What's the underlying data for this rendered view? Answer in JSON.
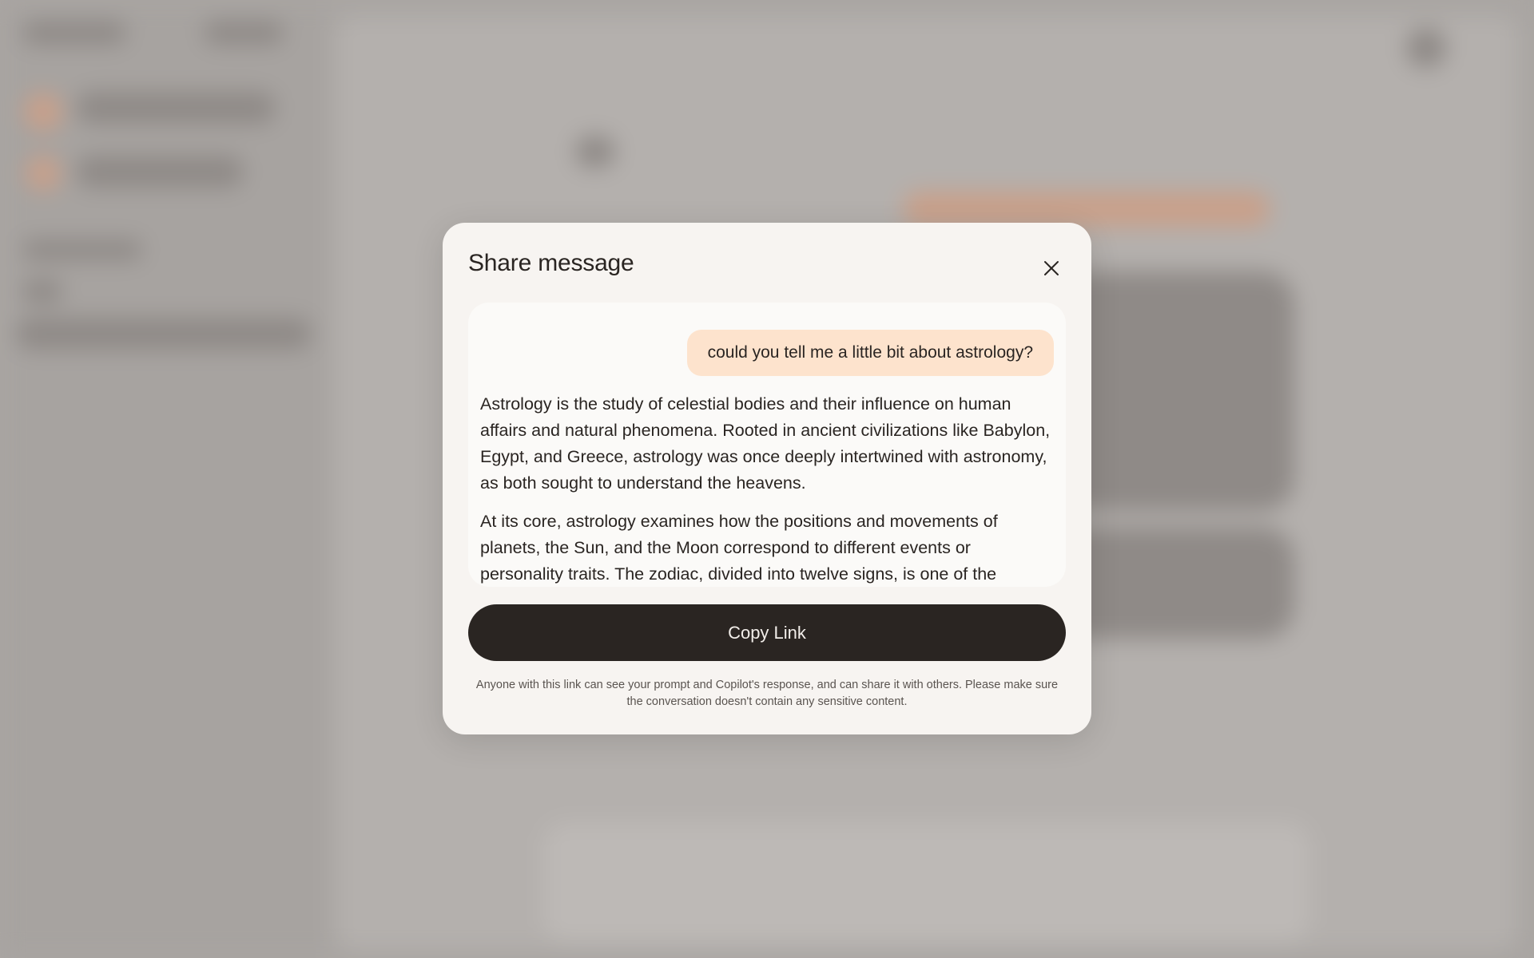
{
  "modal": {
    "title": "Share message",
    "user_prompt": "could you tell me a little bit about astrology?",
    "response_paragraphs": [
      "Astrology is the study of celestial bodies and their influence on human affairs and natural phenomena. Rooted in ancient civilizations like Babylon, Egypt, and Greece, astrology was once deeply intertwined with astronomy, as both sought to understand the heavens.",
      "At its core, astrology examines how the positions and movements of planets, the Sun, and the Moon correspond to different events or personality traits. The zodiac, divided into twelve signs, is one of the"
    ],
    "copy_button_label": "Copy Link",
    "disclaimer": "Anyone with this link can see your prompt and Copilot's response, and can share it with others. Please make sure the conversation doesn't contain any sensitive content."
  },
  "icons": {
    "close": "close-icon"
  },
  "colors": {
    "overlay": "#aaa6a3",
    "modal_bg": "#f7f4f1",
    "user_bubble": "#fde3cd",
    "button_bg": "#2a2522",
    "button_text": "#f2eeea"
  }
}
